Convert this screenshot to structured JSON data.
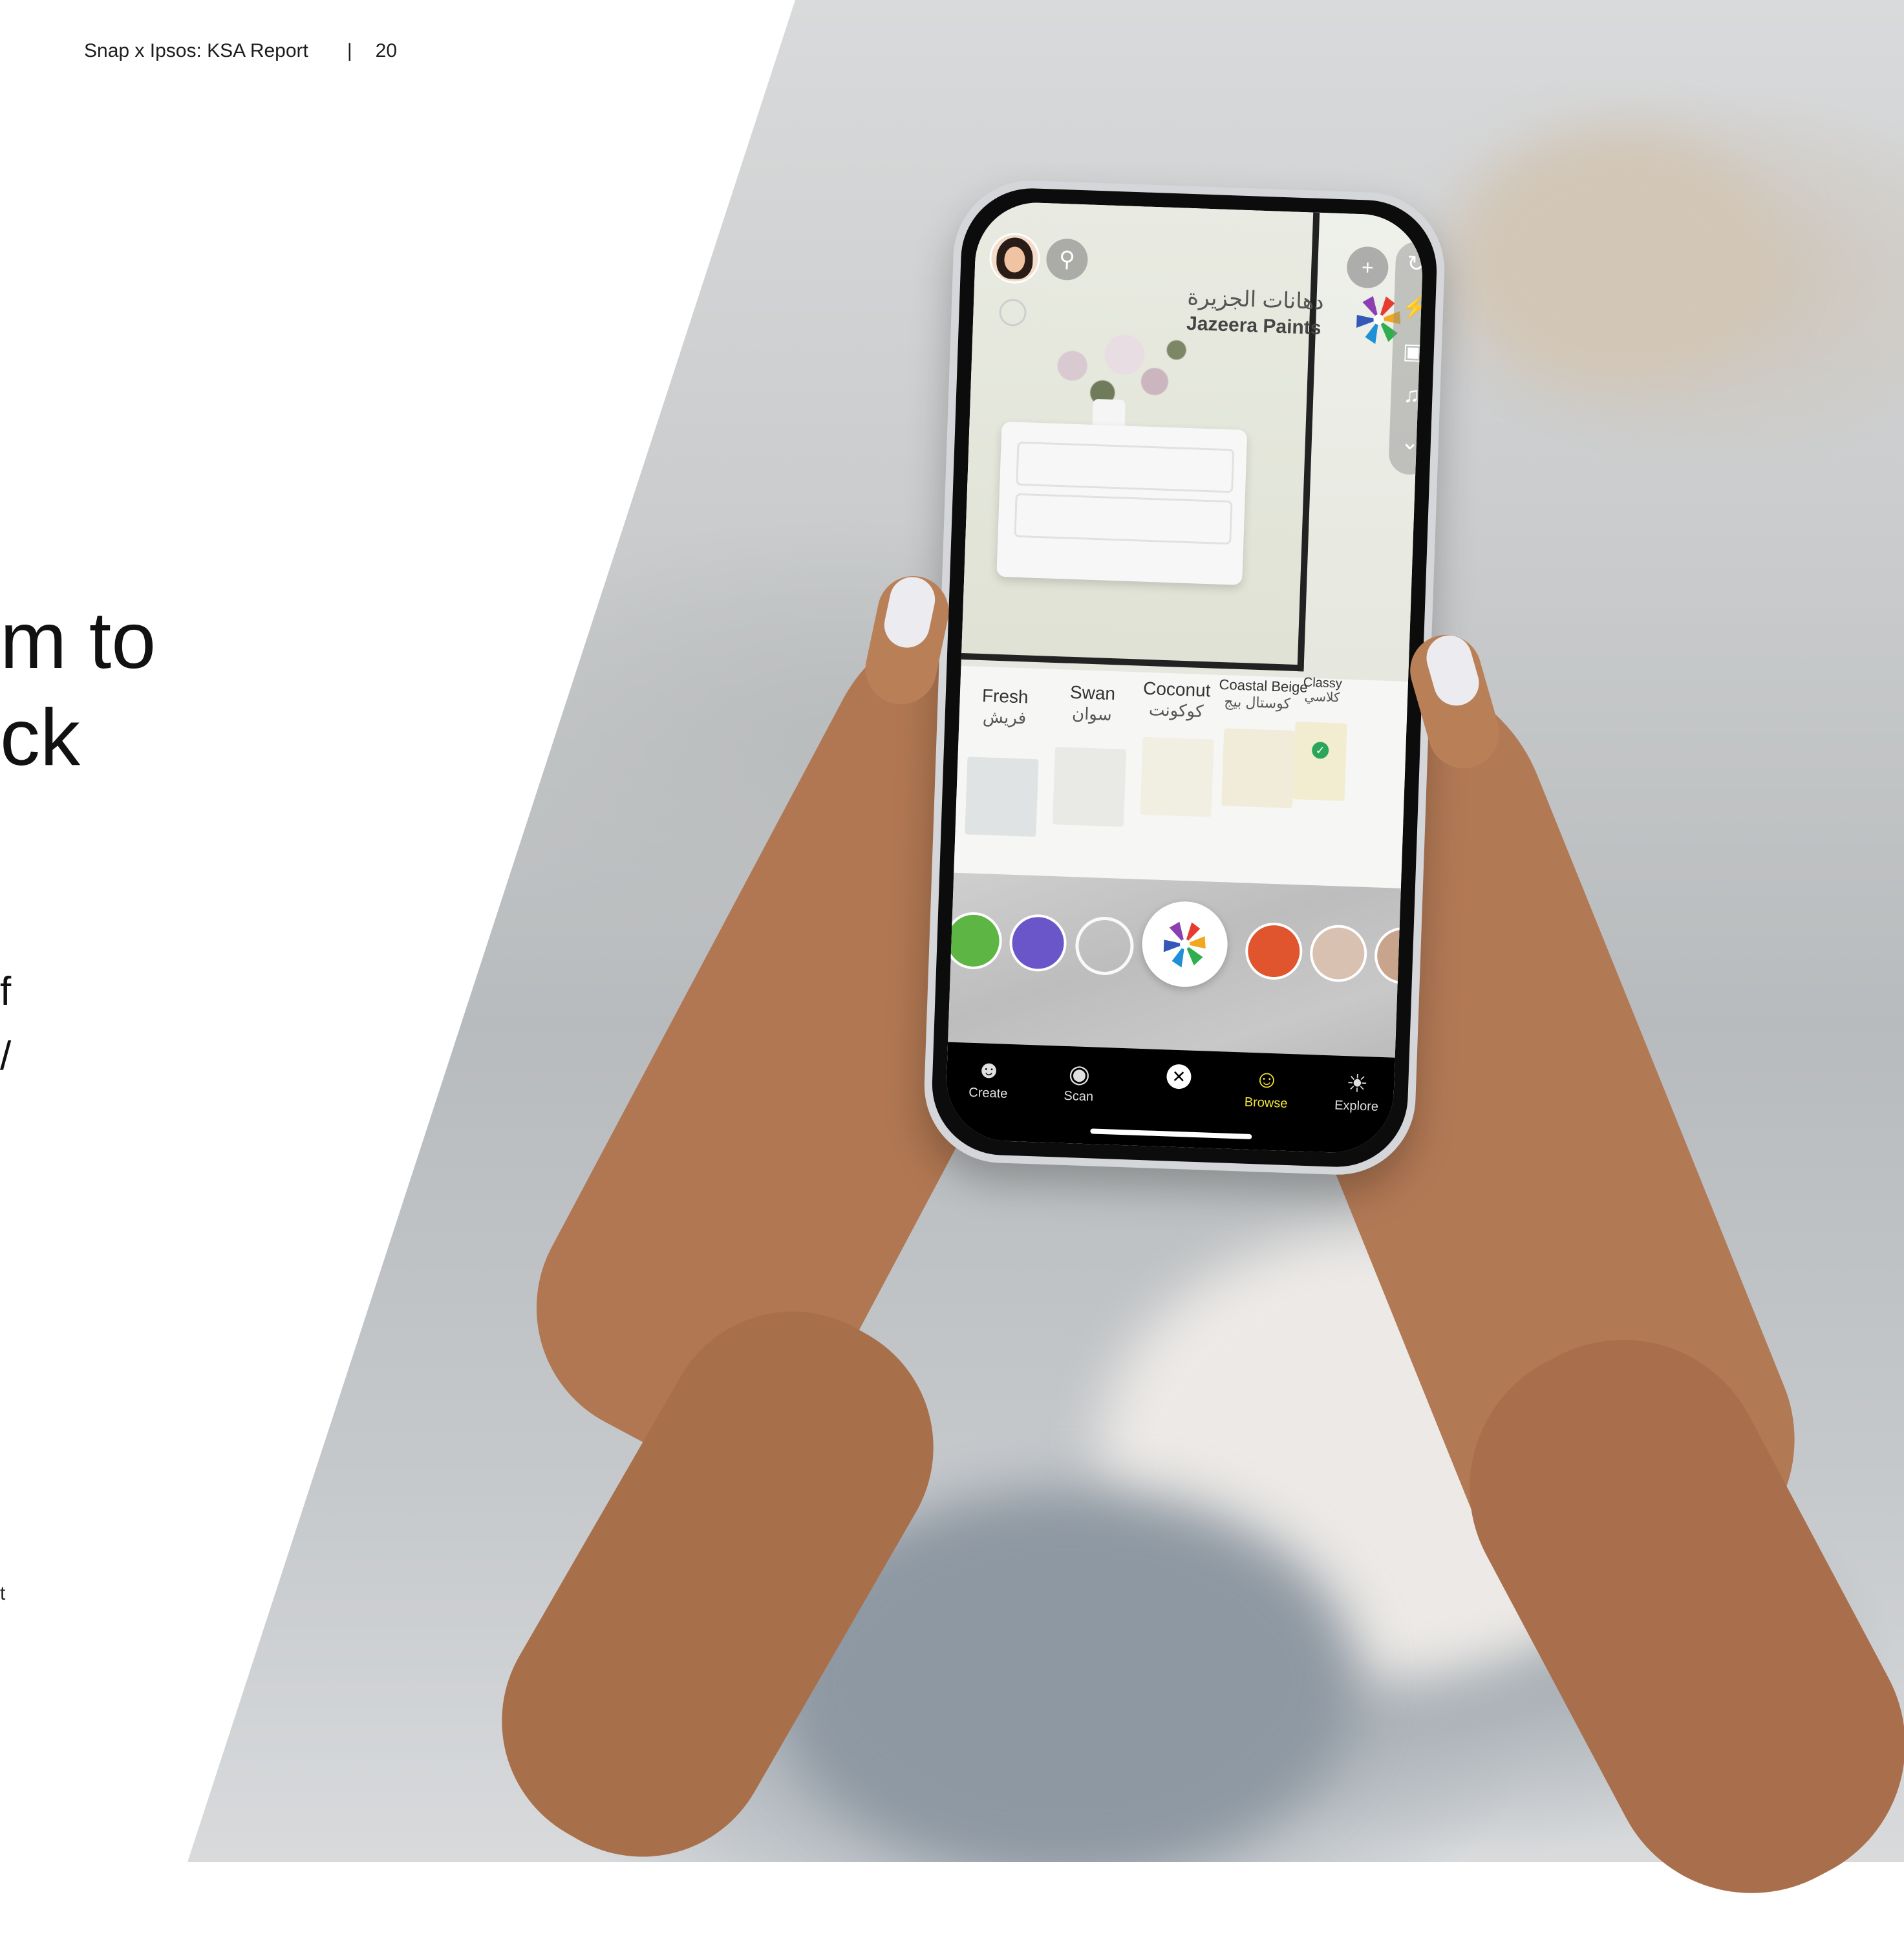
{
  "header": {
    "title": "Snap x Ipsos: KSA Report",
    "separator": "|",
    "page_number": "20"
  },
  "headline": {
    "line1_fragment": "m to",
    "line2_fragment": "ck"
  },
  "body_fragments": {
    "line1": "f",
    "line2": "/"
  },
  "footnote_fragment": "t",
  "phone": {
    "brand_arabic": "دهانات الجزيرة",
    "brand_english": "Jazeera Paints",
    "swatches": [
      {
        "name": "Fresh",
        "arabic": "فريش",
        "color": "#dfe3e3"
      },
      {
        "name": "Swan",
        "arabic": "سوان",
        "color": "#e9e9e6"
      },
      {
        "name": "Coconut",
        "arabic": "كوكونت",
        "color": "#f1eee2"
      },
      {
        "name": "Coastal Beige",
        "arabic": "كوستال بيج",
        "color": "#f0ecd9"
      },
      {
        "name": "Classy",
        "arabic": "كلاسي",
        "color": "#f2ecd0"
      }
    ],
    "nav": [
      {
        "label": "Create",
        "icon": "create-icon"
      },
      {
        "label": "Scan",
        "icon": "scan-icon"
      },
      {
        "label": "",
        "icon": "close-icon"
      },
      {
        "label": "Browse",
        "icon": "smile-icon"
      },
      {
        "label": "Explore",
        "icon": "explore-icon"
      }
    ],
    "accent_color": "#f7e73a"
  }
}
